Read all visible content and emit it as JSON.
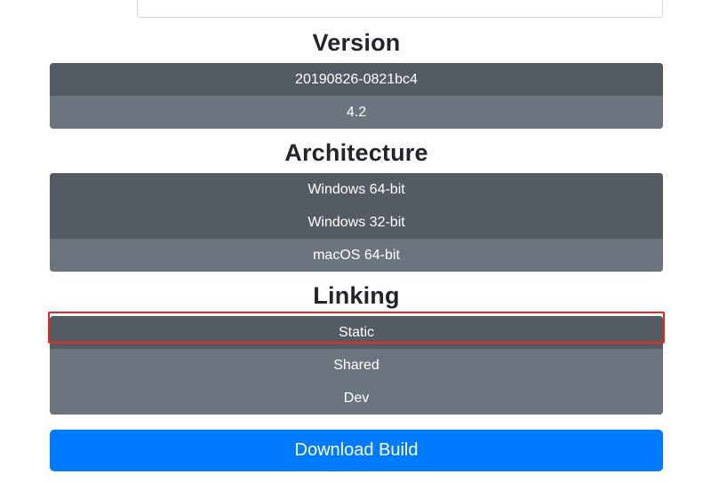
{
  "version": {
    "title": "Version",
    "options": [
      {
        "label": "20190826-0821bc4",
        "active": true
      },
      {
        "label": "4.2",
        "active": false
      }
    ]
  },
  "architecture": {
    "title": "Architecture",
    "options": [
      {
        "label": "Windows 64-bit",
        "active": true
      },
      {
        "label": "Windows 32-bit",
        "active": true
      },
      {
        "label": "macOS 64-bit",
        "active": false
      }
    ]
  },
  "linking": {
    "title": "Linking",
    "options": [
      {
        "label": "Static",
        "active": true
      },
      {
        "label": "Shared",
        "active": false
      },
      {
        "label": "Dev",
        "active": false
      }
    ]
  },
  "download_label": "Download Build",
  "colors": {
    "option_bg": "#6c757d",
    "option_active_bg": "#545b62",
    "primary": "#007bff",
    "highlight": "#e8281d"
  }
}
